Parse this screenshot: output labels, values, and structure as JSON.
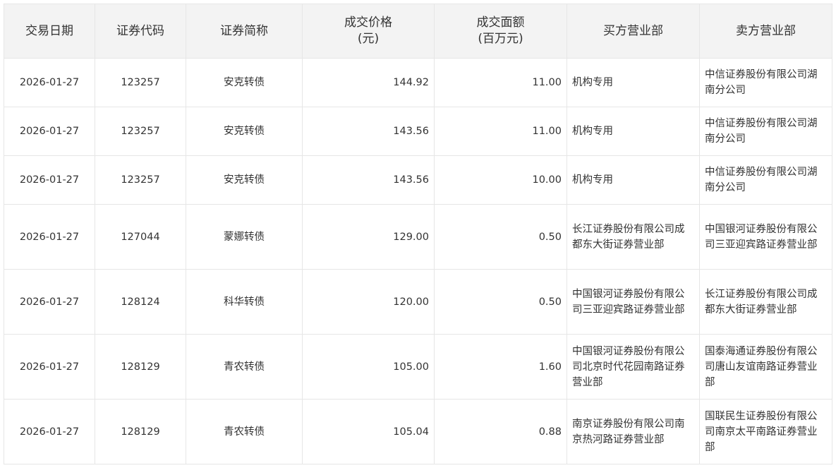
{
  "table": {
    "headers": [
      {
        "line1": "交易日期",
        "line2": ""
      },
      {
        "line1": "证券代码",
        "line2": ""
      },
      {
        "line1": "证券简称",
        "line2": ""
      },
      {
        "line1": "成交价格",
        "line2": "(元)"
      },
      {
        "line1": "成交面额",
        "line2": "(百万元)"
      },
      {
        "line1": "买方营业部",
        "line2": ""
      },
      {
        "line1": "卖方营业部",
        "line2": ""
      }
    ],
    "rows": [
      {
        "date": "2026-01-27",
        "code": "123257",
        "name": "安克转债",
        "price": "144.92",
        "amount": "11.00",
        "buyer": "机构专用",
        "seller": "中信证券股份有限公司湖南分公司"
      },
      {
        "date": "2026-01-27",
        "code": "123257",
        "name": "安克转债",
        "price": "143.56",
        "amount": "11.00",
        "buyer": "机构专用",
        "seller": "中信证券股份有限公司湖南分公司"
      },
      {
        "date": "2026-01-27",
        "code": "123257",
        "name": "安克转债",
        "price": "143.56",
        "amount": "10.00",
        "buyer": "机构专用",
        "seller": "中信证券股份有限公司湖南分公司"
      },
      {
        "date": "2026-01-27",
        "code": "127044",
        "name": "蒙娜转债",
        "price": "129.00",
        "amount": "0.50",
        "buyer": "长江证券股份有限公司成都东大街证券营业部",
        "seller": "中国银河证券股份有限公司三亚迎宾路证券营业部"
      },
      {
        "date": "2026-01-27",
        "code": "128124",
        "name": "科华转债",
        "price": "120.00",
        "amount": "0.50",
        "buyer": "中国银河证券股份有限公司三亚迎宾路证券营业部",
        "seller": "长江证券股份有限公司成都东大街证券营业部"
      },
      {
        "date": "2026-01-27",
        "code": "128129",
        "name": "青农转债",
        "price": "105.00",
        "amount": "1.60",
        "buyer": "中国银河证券股份有限公司北京时代花园南路证券营业部",
        "seller": "国泰海通证券股份有限公司唐山友谊南路证券营业部"
      },
      {
        "date": "2026-01-27",
        "code": "128129",
        "name": "青农转债",
        "price": "105.04",
        "amount": "0.88",
        "buyer": "南京证券股份有限公司南京热河路证券营业部",
        "seller": "国联民生证券股份有限公司南京太平南路证券营业部"
      }
    ]
  }
}
